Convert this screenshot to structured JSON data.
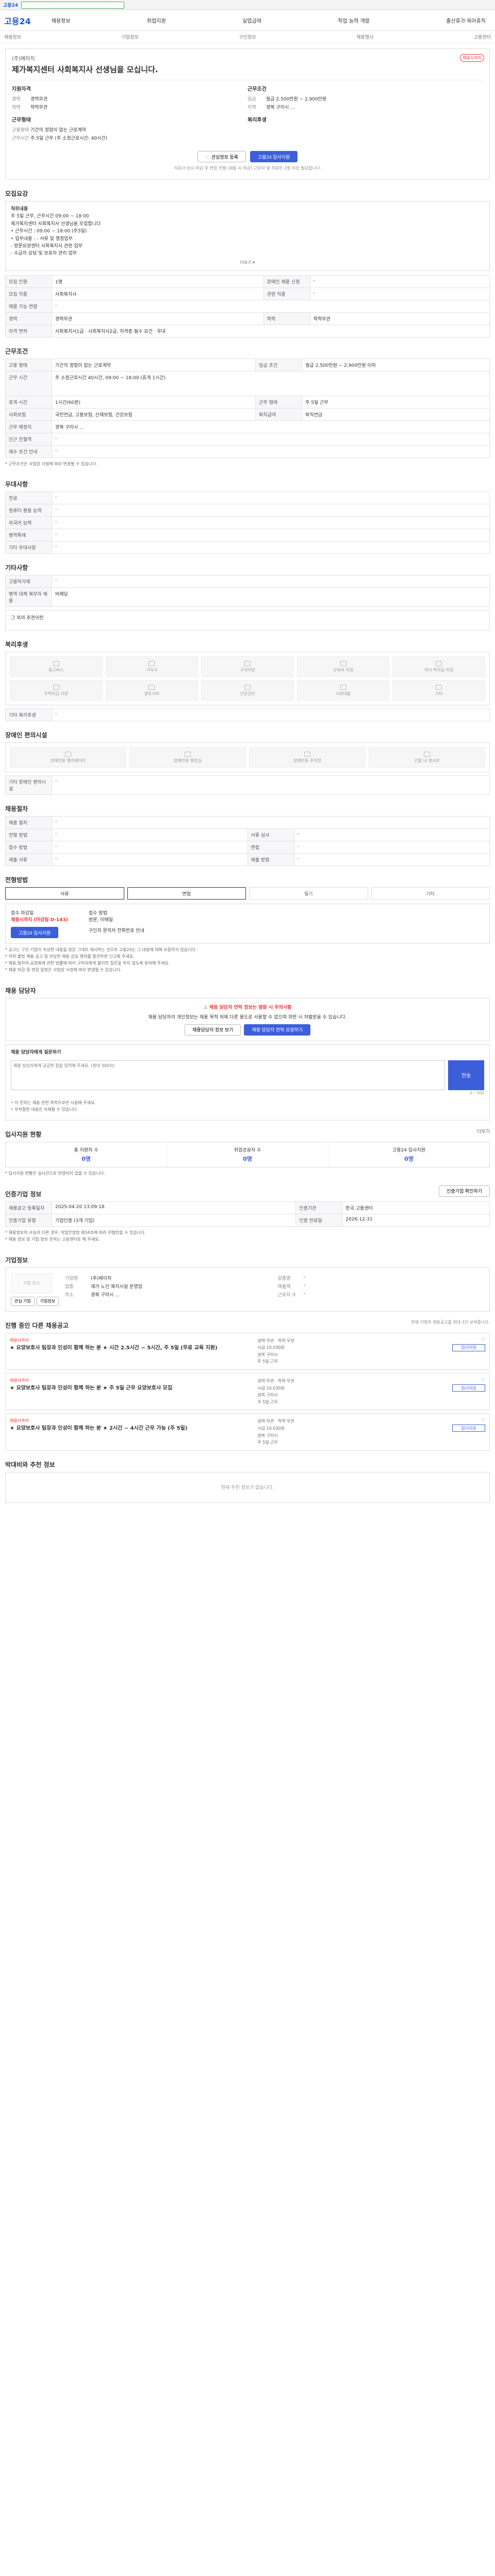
{
  "topbar": {
    "logo": "고용24",
    "search_placeholder": ""
  },
  "header": {
    "brand": "고용24",
    "nav": [
      "채용정보",
      "취업지원",
      "실업급여",
      "직업 능력 개발",
      "출산휴가·육아휴직"
    ]
  },
  "subnav": [
    "채용정보",
    "기업정보",
    "구인정보",
    "채용행사",
    "고용센터"
  ],
  "job": {
    "company": "(주)에이치",
    "title": "제가복지센터 사회복지사 선생님을 모십니다.",
    "badge": "채용시까지",
    "left_heading": "지원자격",
    "left_rows": [
      {
        "k": "경력",
        "v": "경력무관"
      },
      {
        "k": "학력",
        "v": "학력무관"
      }
    ],
    "left_heading2": "근무형태",
    "left_rows2": [
      {
        "k": "고용형태",
        "v": "기간의 정함이 없는 근로계약"
      },
      {
        "k": "근무시간",
        "v": "주 5일 근무 (주 소정근로시간: 40시간)"
      }
    ],
    "right_heading": "근무조건",
    "right_rows": [
      {
        "k": "임금",
        "v": "월급 2,500만원 ~ 2,900만원"
      },
      {
        "k": "지역",
        "v": "경북 구미시 ..."
      }
    ],
    "right_heading2": "복리후생",
    "save_label": "관심정보 등록",
    "apply_label": "고용24 입사지원",
    "note": "지원서 상시 마감 후 면접 진행 (채용 시 마감) 근로자 및 직원은 2명 이상 필요합니다."
  },
  "recruit_section": {
    "title": "모집요강",
    "box_lines": [
      "직무내용",
      "주 5일 근무, 근무시간 09:00 ~ 18:00",
      "제가복지센터 사회복지사 선생님을 모집합니다",
      "• 근무시간 : 09:00 ~ 18:00 (주5일)",
      "• 업무내용 : - 서류 및 행정업무",
      "  - 방문요양센터 사회복지사 관련 업무",
      "  - 수급자 상담 및 보호자 관리 업무"
    ],
    "more": "더보기 ▾",
    "rows": [
      {
        "k1": "모집 인원",
        "v1": "1명",
        "k2": "장애인 채용 신청",
        "v2": "-"
      },
      {
        "k1": "모집 직종",
        "v1": "사회복지사",
        "k2": "관련 직종",
        "v2": "-"
      },
      {
        "k1": "채용 가능 연령",
        "v1": "-",
        "k2": "",
        "v2": ""
      },
      {
        "k1": "경력",
        "v1": "경력무관",
        "k2": "학력",
        "v2": "학력무관"
      },
      {
        "k1": "자격 면허",
        "v1": "사회복지사1급 · 사회복지사2급, 자격증 필수 요건 · 우대",
        "k2": "",
        "v2": ""
      }
    ]
  },
  "conditions_section": {
    "title": "근무조건",
    "rows": [
      {
        "k1": "고용 형태",
        "v1": "기간의 정함이 없는 근로계약",
        "k2": "임금 조건",
        "v2": "월급 2,500만원 ~ 2,900만원 이하"
      },
      {
        "k1": "근무 시간",
        "v1": "주 소정근로시간 40시간, 09:00 ~ 18:00 (휴게 1시간)",
        "k2": "",
        "v2": ""
      },
      {
        "k1": "휴게 시간",
        "v1": "1시간(60분)",
        "k2": "근무 형태",
        "v2": "주 5일 근무"
      },
      {
        "k1": "사회보험",
        "v1": "국민연금, 고용보험, 산재보험, 건강보험",
        "k2": "퇴직급여",
        "v2": "퇴직연금"
      },
      {
        "k1": "근무 예정지",
        "v1": "경북 구미시 ...",
        "k2": "",
        "v2": ""
      },
      {
        "k1": "인근 전철역",
        "v1": "-",
        "k2": "",
        "v2": ""
      },
      {
        "k1": "재수 조건 안내",
        "v1": "-",
        "k2": "",
        "v2": ""
      }
    ],
    "footnote": "* 근무조건은 사업장 사정에 따라 변경될 수 있습니다."
  },
  "preference_section": {
    "title": "우대사항",
    "rows": [
      {
        "k": "전공",
        "v": "-"
      },
      {
        "k": "컴퓨터 활용 능력",
        "v": "-"
      },
      {
        "k": "외국어 능력",
        "v": "-"
      },
      {
        "k": "병역특례",
        "v": "-"
      },
      {
        "k": "기타 우대사항",
        "v": "-"
      }
    ]
  },
  "etc_section": {
    "title": "기타사항",
    "rows": [
      {
        "k": "고용허가제",
        "v": "-"
      },
      {
        "k": "병역 대체 복무자 채용",
        "v": "비해당"
      }
    ],
    "sub": "그 외의 추천이란"
  },
  "welfare_section": {
    "title": "복리후생",
    "items": [
      "통근버스",
      "기숙사",
      "구내식당",
      "교육비 지원",
      "자녀 학자금 지원",
      "주택자금 지원",
      "경조사비",
      "건강검진",
      "사원대출",
      "기타"
    ],
    "etc_label": "기타 복리후생",
    "etc_value": "-"
  },
  "disability_section": {
    "title": "장애인 편의시설",
    "items": [
      "장애인용 엘리베이터",
      "장애인용 화장실",
      "장애인용 주차장",
      "건물 내 경사로"
    ],
    "etc_label": "기타 장애인 편의시설",
    "etc_value": "-"
  },
  "hiring_section": {
    "title": "채용절차",
    "rows": [
      {
        "k1": "채용 절차",
        "v1": "-",
        "k2": "",
        "v2": ""
      },
      {
        "k1": "전형 방법",
        "v1": "-",
        "k2": "서류 심사",
        "v2": "-"
      },
      {
        "k1": "접수 방법",
        "v1": "-",
        "k2": "면접",
        "v2": "-"
      },
      {
        "k1": "제출 서류",
        "v1": "-",
        "k2": "제출 방법",
        "v2": "-"
      }
    ]
  },
  "apply_method_section": {
    "title": "전형방법",
    "methods": [
      "서류",
      "면접",
      "필기",
      "기타"
    ],
    "period_label": "접수 마감일",
    "period_value": "채용시까지 (마감일 D-143)",
    "method_label": "접수 방법",
    "method_value": "방문, 이메일",
    "apply_button": "고용24 입사지원",
    "contact": "구인자 문의처 전화번호 안내",
    "notices": [
      "* 공고는 구인 기업이 작성한 내용을 원문 그대로 게시하는 것으로 고용24는 그 내용에 대해 보증하지 않습니다.",
      "* 허위·불법 채용 공고 및 부당한 채용 강요 행위를 발견하면 신고해 주세요.",
      "* 채용 절차의 공정화에 관한 법률에 따라 구직자에게 불리한 질문을 하지 않도록 유의해 주세요.",
      "* 채용 마감 및 면접 일정은 사업장 사정에 따라 변경될 수 있습니다."
    ]
  },
  "qa_section": {
    "title": "채용 담당자",
    "alert": "채용 담당자 연락 정보는 열람 시 주의사항",
    "desc": "채용 담당자의 개인정보는 채용 목적 외에 다른 용도로 사용할 수 없으며 위반 시 처벌받을 수 있습니다.",
    "btn1": "채용담당자 정보 보기",
    "btn2": "채용 담당자 연락 요청하기",
    "input_label": "채용 담당자에게 질문하기",
    "placeholder": "채용 담당자에게 궁금한 점을 입력해 주세요. (최대 300자)",
    "counter": "0 / 300",
    "send": "전송",
    "notes": [
      "• 이 문의는 채용 관련 목적으로만 사용해 주세요.",
      "• 부적절한 내용은 삭제될 수 있습니다."
    ]
  },
  "stats_section": {
    "title": "입사지원 현황",
    "more": "더보기",
    "items": [
      {
        "label": "총 지원자 수",
        "num": "0명"
      },
      {
        "label": "취업성공자 수",
        "num": "0명"
      },
      {
        "label": "고용24 입사지원",
        "num": "0명"
      }
    ],
    "note": "* 입사지원 현황은 실시간으로 반영되지 않을 수 있습니다."
  },
  "registered_section": {
    "title": "인증기업 정보",
    "btn": "인증기업 확인하기",
    "rows": [
      {
        "k1": "채용공고 등록일자",
        "v1": "2025-04-20 13:09:18",
        "k2": "인증기관",
        "v2": "한국 고용센터"
      },
      {
        "k1": "인증기업 유형",
        "v1": "기업인증 (3개 기업)",
        "k2": "인증 만료일",
        "v2": "2026-12-31"
      }
    ],
    "notes": [
      "* 채용정보의 사실과 다른 경우, 직업안정법 제34조에 따라 처벌받을 수 있습니다.",
      "* 채용 정보 및 기업 정보 문의는 고용센터로 해 주세요."
    ]
  },
  "company_section": {
    "title": "기업정보",
    "logo": "기업 로고",
    "btn1": "관심 기업",
    "btn2": "기업정보",
    "rows": [
      {
        "k": "기업명",
        "v": "(주)에이치"
      },
      {
        "k": "업종",
        "v": "재가 노인 복지시설 운영업"
      },
      {
        "k": "주소",
        "v": "경북 구미시 ..."
      }
    ],
    "rows2": [
      {
        "k": "업종명",
        "v": "-"
      },
      {
        "k": "매출액",
        "v": "-"
      },
      {
        "k": "근로자 수",
        "v": "-"
      }
    ]
  },
  "related_section": {
    "title": "진행 중인 다른 채용공고",
    "note": "현재 기업의 채용공고를 최대 3건 보여줍니다.",
    "cards": [
      {
        "co": "채용시까지",
        "title": "★ 요양보호사 팀장과 인성이 함께 하는 분 ★ 시간 2.5시간 ~ 5시간, 주 5일 (무료 교육 지원)",
        "lines": [
          "경력 무관 · 학력 무관",
          "시급 10,030원",
          "경북 구미시",
          "주 5일 근무"
        ],
        "btn": "입사지원"
      },
      {
        "co": "채용시까지",
        "title": "★ 요양보호사 팀장과 인성이 함께 하는 분 ★ 주 5일 근무 요양보호사 모집",
        "lines": [
          "경력 무관 · 학력 무관",
          "시급 10,030원",
          "경북 구미시",
          "주 5일 근무"
        ],
        "btn": "입사지원"
      },
      {
        "co": "채용시까지",
        "title": "★ 요양보호사 팀장과 인성이 함께 하는 분 ★ 2시간 ~ 4시간 근무 가능 (주 5일)",
        "lines": [
          "경력 무관 · 학력 무관",
          "시급 10,030원",
          "경북 구미시",
          "주 5일 근무"
        ],
        "btn": "입사지원"
      }
    ]
  },
  "recommend_section": {
    "title": "박대비와 추천 정보",
    "empty": "현재 추천 정보가 없습니다."
  }
}
